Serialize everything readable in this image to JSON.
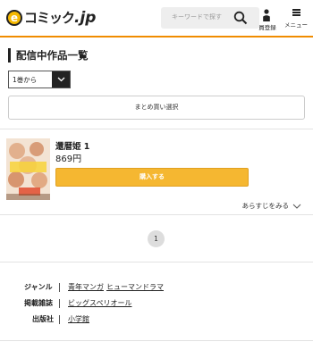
{
  "header": {
    "logo_mark": "e",
    "logo_text": "コミック",
    "logo_jp": ".jp",
    "search_placeholder": "キーワードで探す",
    "register_label": "員登録",
    "menu_label": "メニュー"
  },
  "section_title": "配信中作品一覧",
  "volume_select": {
    "selected": "1巻から"
  },
  "bulk_buy_label": "まとめ買い選択",
  "item": {
    "title": "還暦姫 1",
    "price": "869円",
    "buy_label": "購入する",
    "synopsis_label": "あらすじをみる"
  },
  "pagination": {
    "current": "1"
  },
  "meta": {
    "genre_label": "ジャンル",
    "genres": [
      "青年マンガ",
      "ヒューマンドラマ"
    ],
    "magazine_label": "掲載雑誌",
    "magazine": "ビッグスペリオール",
    "publisher_label": "出版社",
    "publisher": "小学館"
  }
}
